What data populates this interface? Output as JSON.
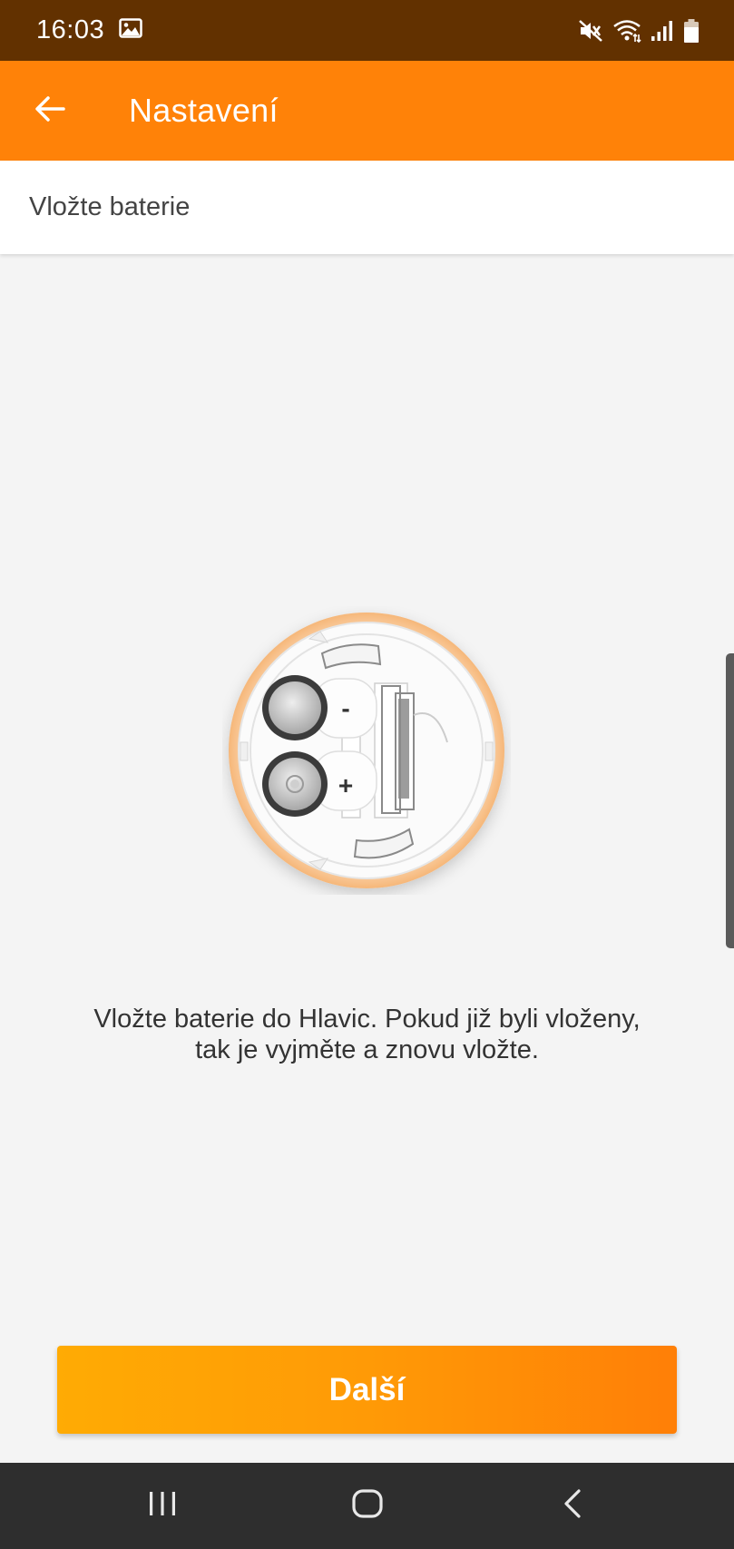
{
  "status_bar": {
    "time": "16:03",
    "icons": [
      "gallery-icon",
      "mute-icon",
      "wifi-icon",
      "signal-icon",
      "battery-icon"
    ]
  },
  "app_bar": {
    "title": "Nastavení",
    "back_icon": "arrow-left-icon"
  },
  "step": {
    "title": "Vložte baterie"
  },
  "illustration": {
    "minus_label": "-",
    "plus_label": "+",
    "accent_color": "#f9c48f"
  },
  "instruction": {
    "line1": "Vložte baterie do Hlavic. Pokud již byli vloženy,",
    "line2": "tak je vyjměte a znovu vložte."
  },
  "next_button": {
    "label": "Další"
  },
  "nav_bar": {
    "icons": [
      "recents-icon",
      "home-icon",
      "back-icon"
    ]
  },
  "colors": {
    "status_bar": "#623100",
    "app_bar": "#ff8208",
    "button_start": "#ffab04",
    "button_end": "#ff7f07",
    "background": "#f4f4f4",
    "nav_bar": "#2e2e2e"
  }
}
